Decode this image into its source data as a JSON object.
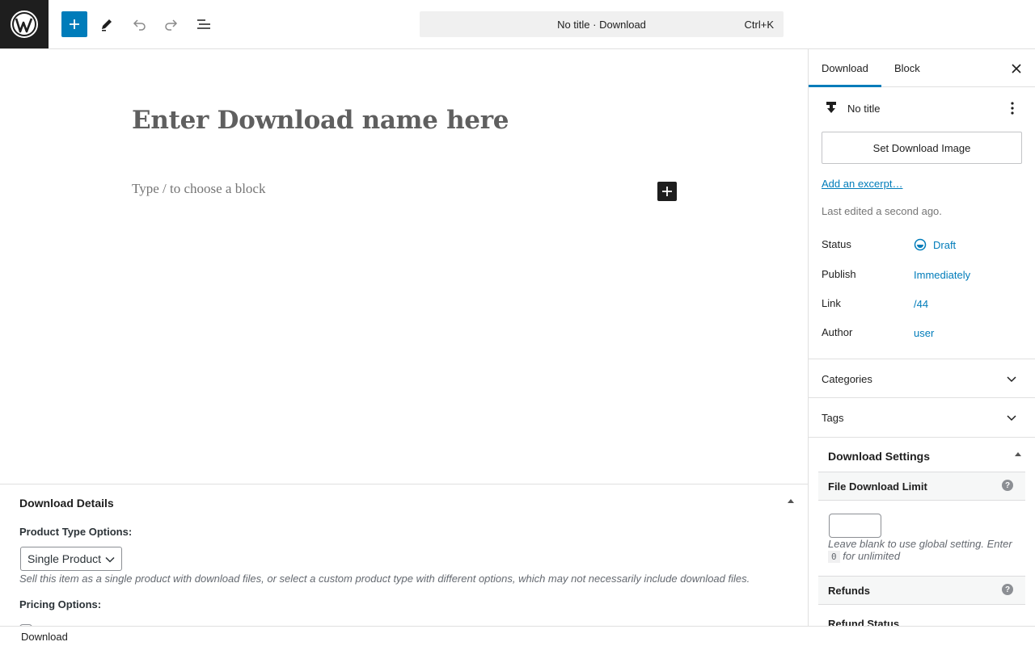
{
  "topbar": {
    "command_bar": {
      "title": "No title · Download",
      "shortcut": "Ctrl+K"
    }
  },
  "editor": {
    "title_placeholder": "Enter Download name here",
    "block_placeholder": "Type / to choose a block"
  },
  "download_details": {
    "heading": "Download Details",
    "product_type_label": "Product Type Options:",
    "product_type_value": "Single Product",
    "product_type_description": "Sell this item as a single product with download files, or select a custom product type with different options, which may not necessarily include download files.",
    "pricing_label": "Pricing Options:"
  },
  "sidebar": {
    "tabs": [
      {
        "label": "Download"
      },
      {
        "label": "Block"
      }
    ],
    "post_title": "No title",
    "set_image_label": "Set Download Image",
    "excerpt_link": "Add an excerpt…",
    "last_edited": "Last edited a second ago.",
    "rows": {
      "status": {
        "label": "Status",
        "value": "Draft"
      },
      "publish": {
        "label": "Publish",
        "value": "Immediately"
      },
      "link": {
        "label": "Link",
        "value": "/44"
      },
      "author": {
        "label": "Author",
        "value": "user"
      }
    },
    "panels": {
      "categories": "Categories",
      "tags": "Tags"
    },
    "download_settings": {
      "heading": "Download Settings",
      "file_limit_label": "File Download Limit",
      "file_limit_value": "",
      "hint_before": "Leave blank to use global setting. Enter",
      "hint_code": "0",
      "hint_after": "for unlimited",
      "refunds_label": "Refunds",
      "refund_status_label": "Refund Status"
    }
  },
  "statusbar": {
    "breadcrumb": "Download"
  },
  "colors": {
    "accent": "#007cba",
    "dark": "#1e1e1e"
  }
}
